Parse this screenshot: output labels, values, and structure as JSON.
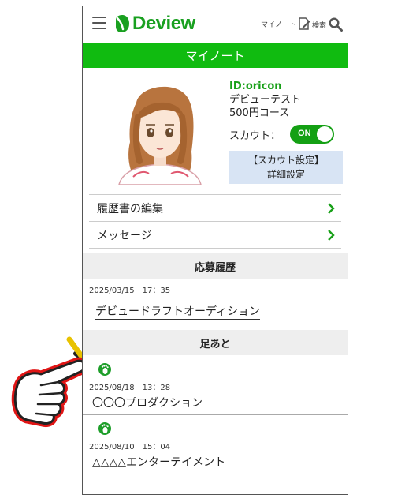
{
  "header": {
    "logo_text": "Deview",
    "note_label": "マイノート",
    "search_label": "検索",
    "menu_icon": "hamburger-icon",
    "note_icon": "note-edit-icon",
    "search_icon": "search-icon",
    "brand_color": "#19a020"
  },
  "page": {
    "title": "マイノート",
    "title_color": "#10bb10"
  },
  "profile": {
    "id": "ID:oricon",
    "name": "デビューテスト",
    "course": "500円コース",
    "scout_label": "スカウト：",
    "scout_toggle": "ON",
    "scout_enabled": true,
    "scout_settings_line1": "【スカウト設定】",
    "scout_settings_line2": "詳細設定"
  },
  "menu": [
    {
      "label": "履歴書の編集",
      "icon": "chevron-right-icon"
    },
    {
      "label": "メッセージ",
      "icon": "chevron-right-icon"
    }
  ],
  "applications": {
    "title": "応募履歴",
    "items": [
      {
        "date": "2025/03/15　17：35",
        "name": "デビュードラフトオーディション"
      }
    ]
  },
  "footprints": {
    "title": "足あと",
    "icon": "footprint-icon",
    "items": [
      {
        "date": "2025/08/18　13：28",
        "name": "〇〇〇プロダクション"
      },
      {
        "date": "2025/08/10　15：04",
        "name": "△△△△エンターテイメント"
      }
    ]
  }
}
